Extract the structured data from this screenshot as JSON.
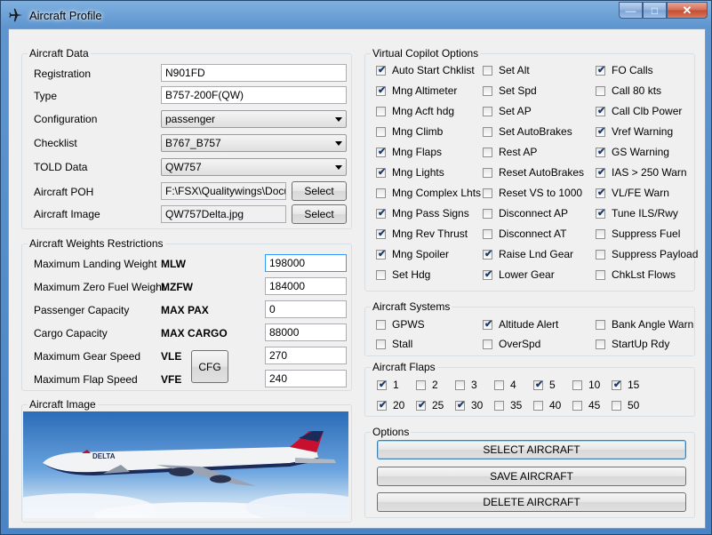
{
  "window": {
    "title": "Aircraft Profile",
    "controls": {
      "minimize": "—",
      "maximize": "□",
      "close": "✕"
    }
  },
  "aircraft_data": {
    "group_label": "Aircraft Data",
    "registration": {
      "label": "Registration",
      "value": "N901FD"
    },
    "type": {
      "label": "Type",
      "value": "B757-200F(QW)"
    },
    "configuration": {
      "label": "Configuration",
      "value": "passenger"
    },
    "checklist": {
      "label": "Checklist",
      "value": "B767_B757"
    },
    "told_data": {
      "label": "TOLD Data",
      "value": "QW757"
    },
    "aircraft_poh": {
      "label": "Aircraft POH",
      "value": "F:\\FSX\\Qualitywings\\Docum",
      "button": "Select"
    },
    "aircraft_image": {
      "label": "Aircraft Image",
      "value": "QW757Delta.jpg",
      "button": "Select"
    }
  },
  "weights": {
    "group_label": "Aircraft Weights  Restrictions",
    "rows": [
      {
        "label": "Maximum Landing Weight",
        "code": "MLW",
        "value": "198000"
      },
      {
        "label": "Maximum Zero Fuel Weight",
        "code": "MZFW",
        "value": "184000"
      },
      {
        "label": "Passenger Capacity",
        "code": "MAX PAX",
        "value": "0"
      },
      {
        "label": "Cargo Capacity",
        "code": "MAX CARGO",
        "value": "88000"
      },
      {
        "label": "Maximum Gear Speed",
        "code": "VLE",
        "value": "270"
      },
      {
        "label": "Maximum Flap Speed",
        "code": "VFE",
        "value": "240"
      }
    ],
    "cfg_button": "CFG"
  },
  "image_panel": {
    "group_label": "Aircraft Image",
    "livery_text": "DELTA"
  },
  "copilot": {
    "group_label": "Virtual Copilot Options",
    "col1": [
      {
        "label": "Auto Start Chklist",
        "checked": true
      },
      {
        "label": "Mng Altimeter",
        "checked": true
      },
      {
        "label": "Mng Acft hdg",
        "checked": false
      },
      {
        "label": "Mng Climb",
        "checked": false
      },
      {
        "label": "Mng Flaps",
        "checked": true
      },
      {
        "label": "Mng Lights",
        "checked": true
      },
      {
        "label": "Mng Complex Lhts",
        "checked": false
      },
      {
        "label": "Mng Pass Signs",
        "checked": true
      },
      {
        "label": "Mng Rev Thrust",
        "checked": true
      },
      {
        "label": "Mng Spoiler",
        "checked": true
      },
      {
        "label": "Set Hdg",
        "checked": false
      }
    ],
    "col2": [
      {
        "label": "Set Alt",
        "checked": false
      },
      {
        "label": "Set Spd",
        "checked": false
      },
      {
        "label": "Set AP",
        "checked": false
      },
      {
        "label": "Set AutoBrakes",
        "checked": false
      },
      {
        "label": "Rest AP",
        "checked": false
      },
      {
        "label": "Reset AutoBrakes",
        "checked": false
      },
      {
        "label": "Reset VS to 1000",
        "checked": false
      },
      {
        "label": "Disconnect AP",
        "checked": false
      },
      {
        "label": "Disconnect AT",
        "checked": false
      },
      {
        "label": "Raise Lnd Gear",
        "checked": true
      },
      {
        "label": "Lower Gear",
        "checked": true
      }
    ],
    "col3": [
      {
        "label": "FO Calls",
        "checked": true
      },
      {
        "label": "Call 80 kts",
        "checked": false
      },
      {
        "label": "Call Clb Power",
        "checked": true
      },
      {
        "label": "Vref Warning",
        "checked": true
      },
      {
        "label": "GS Warning",
        "checked": true
      },
      {
        "label": "IAS > 250 Warn",
        "checked": true
      },
      {
        "label": "VL/FE Warn",
        "checked": true
      },
      {
        "label": "Tune ILS/Rwy",
        "checked": true
      },
      {
        "label": "Suppress Fuel",
        "checked": false
      },
      {
        "label": "Suppress Payload",
        "checked": false
      },
      {
        "label": "ChkLst Flows",
        "checked": false
      }
    ]
  },
  "systems": {
    "group_label": "Aircraft Systems",
    "items": [
      {
        "label": "GPWS",
        "checked": false
      },
      {
        "label": "Altitude Alert",
        "checked": true
      },
      {
        "label": "Bank Angle Warn",
        "checked": false
      },
      {
        "label": "Stall",
        "checked": false
      },
      {
        "label": "OverSpd",
        "checked": false
      },
      {
        "label": "StartUp Rdy",
        "checked": false
      }
    ]
  },
  "flaps": {
    "group_label": "Aircraft Flaps",
    "items": [
      {
        "label": "1",
        "checked": true
      },
      {
        "label": "2",
        "checked": false
      },
      {
        "label": "3",
        "checked": false
      },
      {
        "label": "4",
        "checked": false
      },
      {
        "label": "5",
        "checked": true
      },
      {
        "label": "10",
        "checked": false
      },
      {
        "label": "15",
        "checked": true
      },
      {
        "label": "20",
        "checked": true
      },
      {
        "label": "25",
        "checked": true
      },
      {
        "label": "30",
        "checked": true
      },
      {
        "label": "35",
        "checked": false
      },
      {
        "label": "40",
        "checked": false
      },
      {
        "label": "45",
        "checked": false
      },
      {
        "label": "50",
        "checked": false
      }
    ]
  },
  "options": {
    "group_label": "Options",
    "select": "SELECT AIRCRAFT",
    "save": "SAVE AIRCRAFT",
    "delete": "DELETE AIRCRAFT"
  },
  "check_glyph": "✔",
  "colors": {
    "titlebar": "#5e95cf",
    "client": "#f0f0f0",
    "default_button_border": "#3c7fb1"
  }
}
